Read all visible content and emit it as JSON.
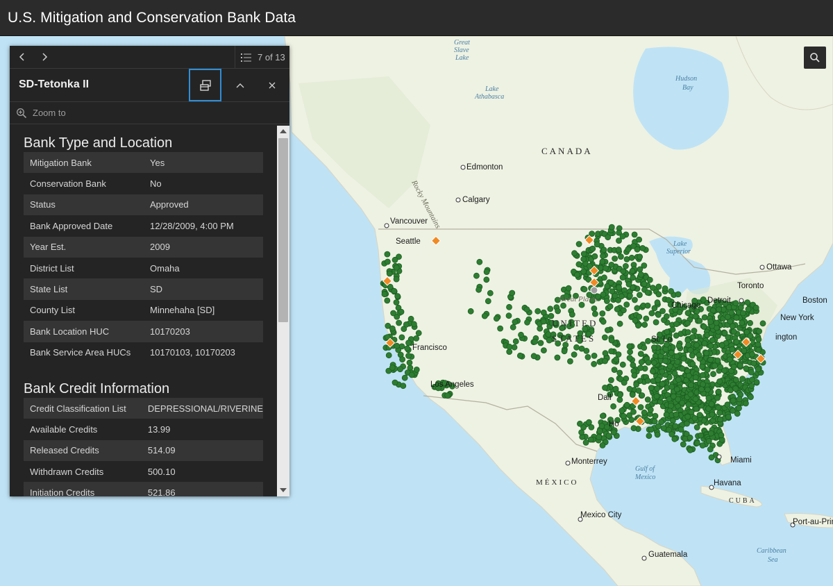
{
  "app": {
    "title": "U.S. Mitigation and Conservation Bank Data"
  },
  "popup": {
    "pager_text": "7 of 13",
    "feature_title": "SD-Tetonka II",
    "zoom_label": "Zoom to",
    "sections": [
      {
        "title": "Bank Type and Location",
        "rows": [
          {
            "key": "Mitigation Bank",
            "value": "Yes"
          },
          {
            "key": "Conservation Bank",
            "value": "No"
          },
          {
            "key": "Status",
            "value": "Approved"
          },
          {
            "key": "Bank Approved Date",
            "value": "12/28/2009, 4:00 PM"
          },
          {
            "key": "Year Est.",
            "value": "2009"
          },
          {
            "key": "District List",
            "value": "Omaha"
          },
          {
            "key": "State List",
            "value": "SD"
          },
          {
            "key": "County List",
            "value": "Minnehaha [SD]"
          },
          {
            "key": "Bank Location HUC",
            "value": "10170203"
          },
          {
            "key": "Bank Service Area HUCs",
            "value": "10170103, 10170203"
          }
        ]
      },
      {
        "title": "Bank Credit Information",
        "rows": [
          {
            "key": "Credit Classification List",
            "value": "DEPRESSIONAL/RIVERINE"
          },
          {
            "key": "Available Credits",
            "value": "13.99"
          },
          {
            "key": "Released Credits",
            "value": "514.09"
          },
          {
            "key": "Withdrawn Credits",
            "value": "500.10"
          },
          {
            "key": "Initiation Credits",
            "value": "521.86"
          }
        ]
      }
    ]
  },
  "map": {
    "labels": {
      "canada": "CANADA",
      "united": "UNITED",
      "states": "STATES",
      "mexico": "MÉXICO",
      "cuba": "CUBA",
      "edmonton": "Edmonton",
      "calgary": "Calgary",
      "vancouver": "Vancouver",
      "seattle": "Seattle",
      "chicago": "Chicago",
      "detroit": "Detroit",
      "toronto": "Toronto",
      "ottawa": "Ottawa",
      "boston": "Boston",
      "newyork": "New York",
      "washington": "ington",
      "stlouis": "St. Lo",
      "dallas": "Dall",
      "houston": "Ho",
      "sanfrancisco": "Francisco",
      "losangeles": "Los Angeles",
      "monterrey": "Monterrey",
      "mexicocity": "Mexico City",
      "guatemala": "Guatemala",
      "havana": "Havana",
      "miami": "Miami",
      "portauprince": "Port-au-Prin",
      "greatslave1": "Great",
      "greatslave2": "Slave",
      "greatslave3": "Lake",
      "athabasca1": "Lake",
      "athabasca2": "Athabasca",
      "hudson1": "Hudson",
      "hudson2": "Bay",
      "superior1": "Lake",
      "superior2": "Superior",
      "gulf1": "Gulf of",
      "gulf2": "Mexico",
      "caribbean1": "Caribbean",
      "caribbean2": "Sea",
      "greatplains": "Great Plains",
      "rockies": "Rocky Mountains"
    },
    "colors": {
      "bank_point": "#2e7d32",
      "highlight_point": "#f08a24",
      "water": "#bfe3f5",
      "land": "#eef2e6"
    }
  }
}
